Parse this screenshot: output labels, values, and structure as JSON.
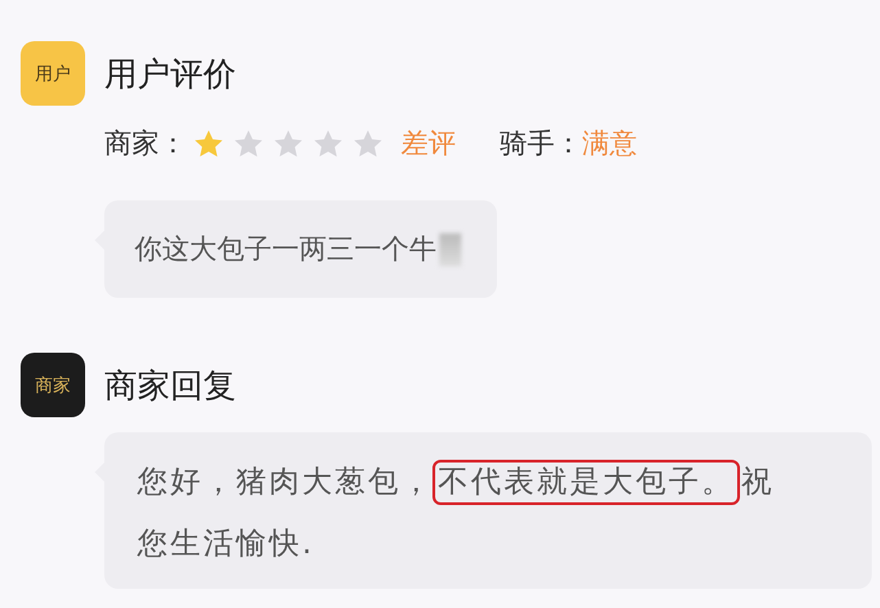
{
  "review": {
    "avatar": "用户",
    "title": "用户评价",
    "merchant_label": "商家：",
    "stars": 1,
    "merchant_verdict": "差评",
    "rider_label": "骑手：",
    "rider_verdict": "满意",
    "comment": "你这大包子一两三一个牛"
  },
  "reply": {
    "avatar": "商家",
    "title": "商家回复",
    "text_before": "您好，猪肉大葱包，",
    "highlight": "不代表就是大包子。",
    "text_after": "祝您生活愉快."
  }
}
